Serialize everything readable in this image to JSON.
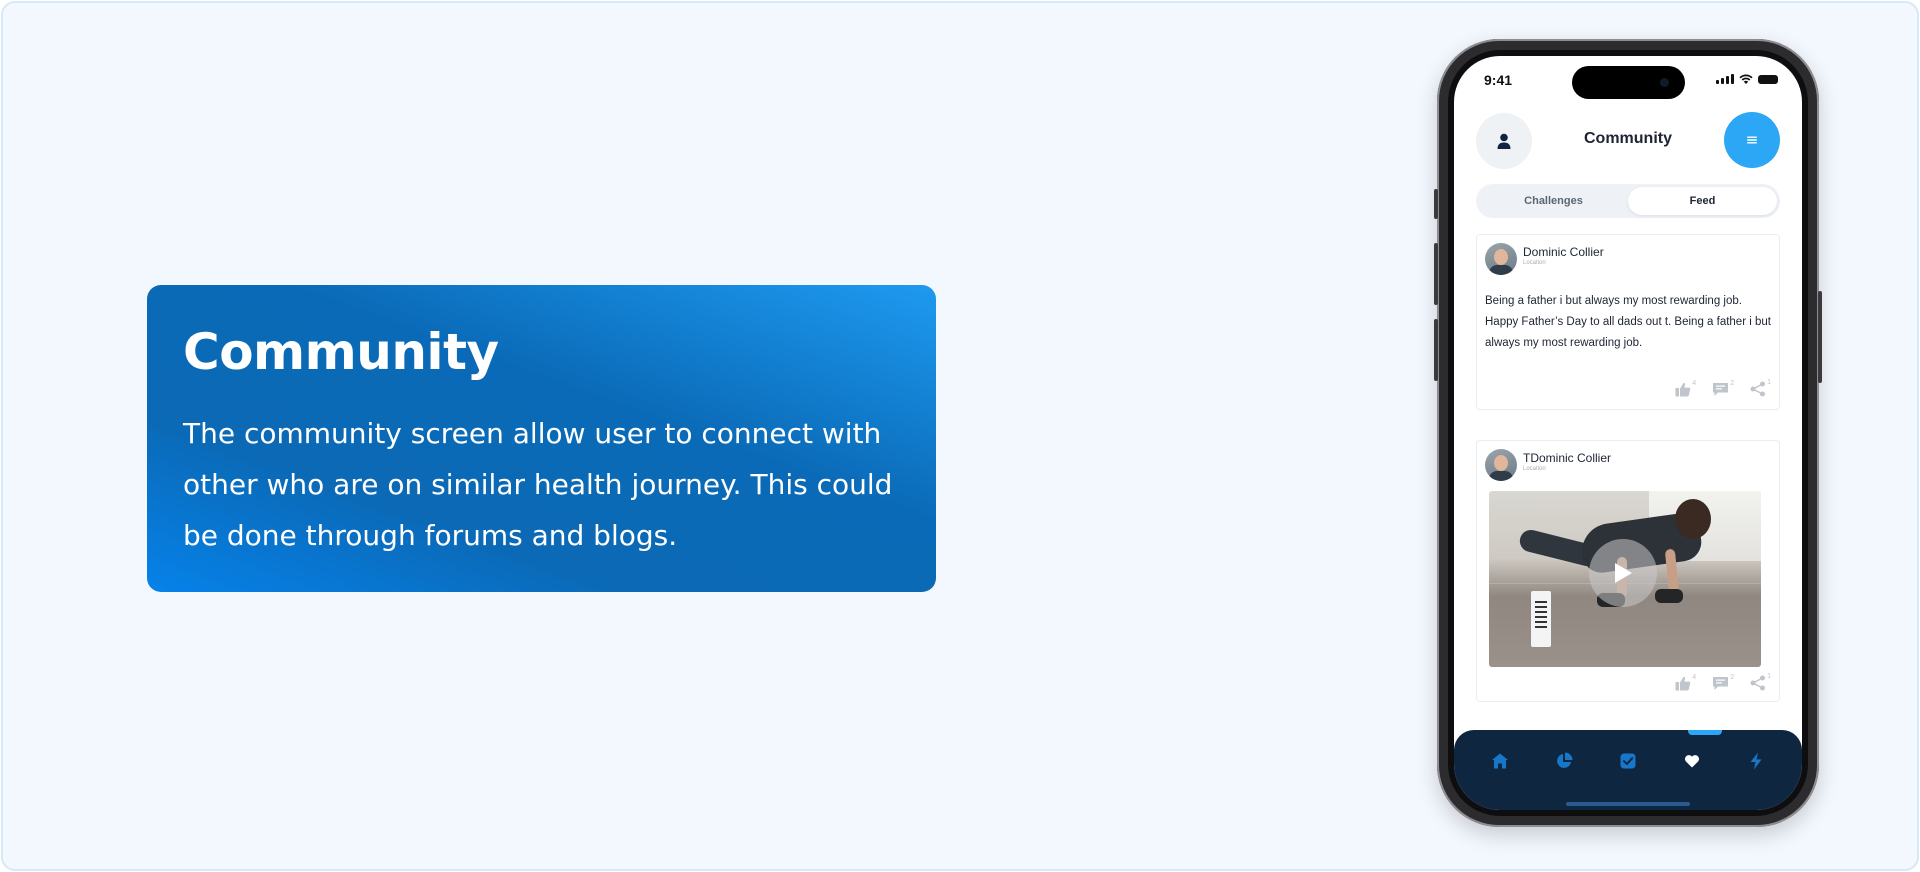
{
  "info": {
    "title": "Community",
    "description": "The community screen allow user to connect with other who are on similar health journey. This could be done through forums and blogs."
  },
  "phone": {
    "status_time": "9:41",
    "header": {
      "title": "Community",
      "profile_icon": "user-icon",
      "menu_icon": "menu-icon"
    },
    "tabs": [
      {
        "label": "Challenges",
        "active": false
      },
      {
        "label": "Feed",
        "active": true
      }
    ],
    "posts": [
      {
        "author": "Dominic Collier",
        "location": "Location",
        "text": "Being a father i but always my most rewarding job. Happy Father’s Day to all dads out t. Being a father i but always my most rewarding job.",
        "likes": "4",
        "comments": "2",
        "shares": "1"
      },
      {
        "author": "TDominic Collier",
        "location": "Location",
        "media": "video",
        "likes": "4",
        "comments": "2",
        "shares": "1"
      }
    ],
    "bottom_nav": [
      {
        "icon": "home-icon",
        "active": false
      },
      {
        "icon": "pie-chart-icon",
        "active": false
      },
      {
        "icon": "checkbox-icon",
        "active": false
      },
      {
        "icon": "heart-icon",
        "active": true
      },
      {
        "icon": "lightning-icon",
        "active": false
      }
    ]
  },
  "colors": {
    "accent": "#2ba7f5",
    "nav_background": "#0f2640",
    "card_gradient_start": "#0682ea",
    "card_gradient_end": "#1e9af0"
  }
}
